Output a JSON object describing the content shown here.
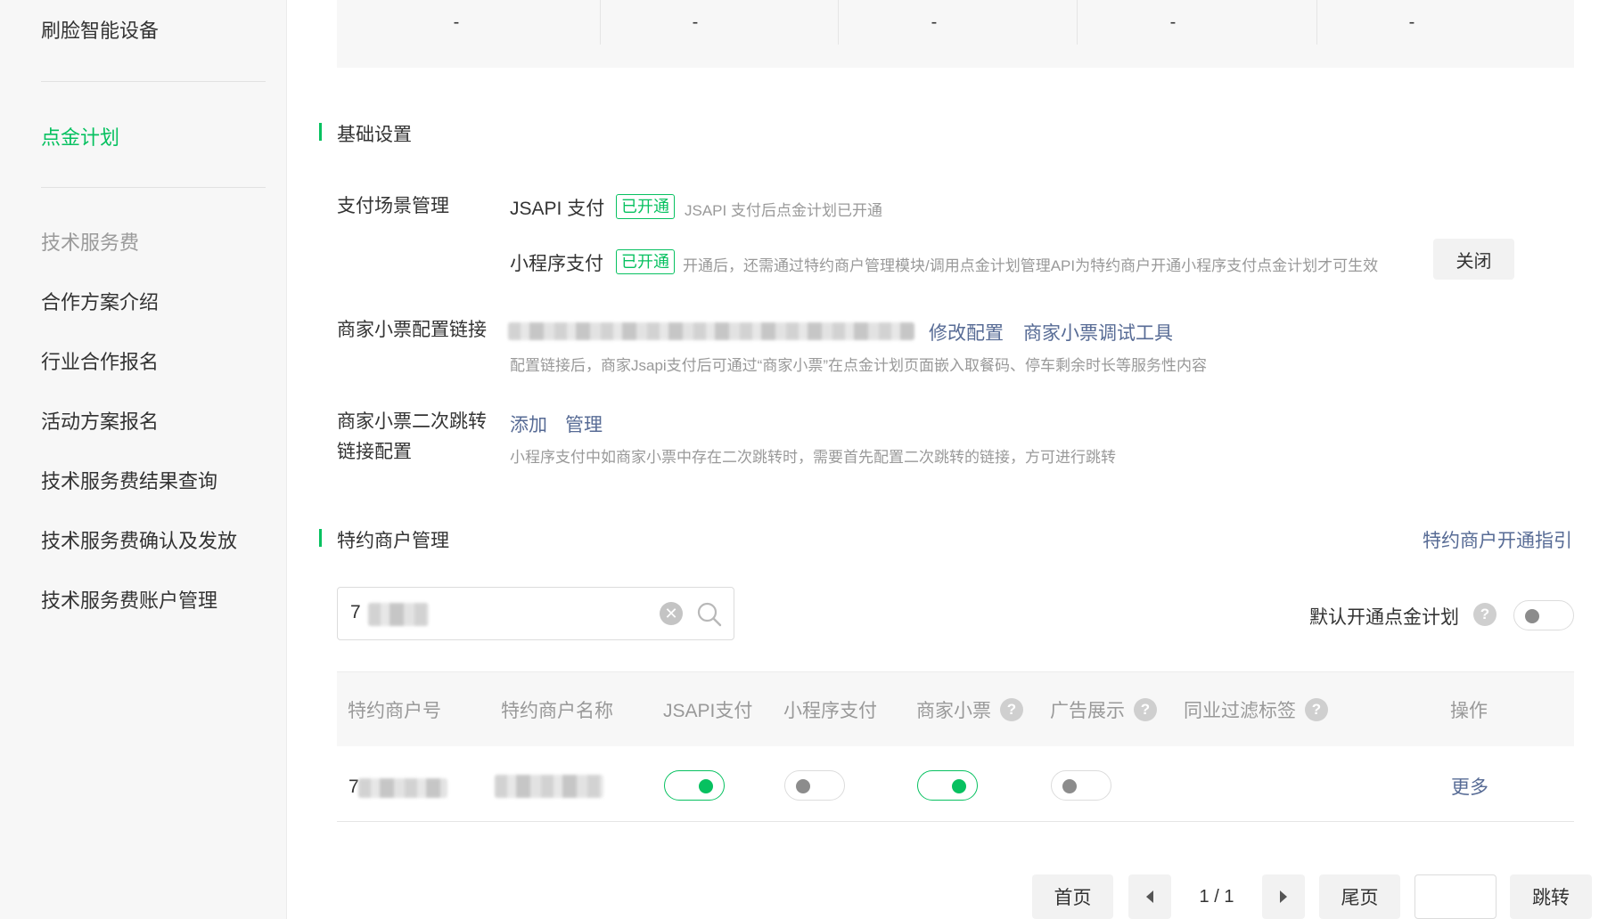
{
  "sidebar": {
    "top_item": "刷脸智能设备",
    "active_item": "点金计划",
    "group_title": "技术服务费",
    "items": [
      "合作方案介绍",
      "行业合作报名",
      "活动方案报名",
      "技术服务费结果查询",
      "技术服务费确认及发放",
      "技术服务费账户管理"
    ]
  },
  "summary": {
    "values": [
      "-",
      "-",
      "-",
      "-",
      "-"
    ]
  },
  "basic": {
    "title": "基础设置",
    "scene_label": "支付场景管理",
    "jsapi": {
      "name": "JSAPI 支付",
      "status": "已开通",
      "desc": "JSAPI 支付后点金计划已开通"
    },
    "mini": {
      "name": "小程序支付",
      "status": "已开通",
      "desc": "开通后，还需通过特约商户管理模块/调用点金计划管理API为特约商户开通小程序支付点金计划才可生效",
      "close_btn": "关闭"
    },
    "receipt_label": "商家小票配置链接",
    "receipt_modify": "修改配置",
    "receipt_debug": "商家小票调试工具",
    "receipt_hint": "配置链接后，商家Jsapi支付后可通过“商家小票”在点金计划页面嵌入取餐码、停车剩余时长等服务性内容",
    "redirect_label_1": "商家小票二次跳转",
    "redirect_label_2": "链接配置",
    "redirect_add": "添加",
    "redirect_manage": "管理",
    "redirect_hint": "小程序支付中如商家小票中存在二次跳转时，需要首先配置二次跳转的链接，方可进行跳转"
  },
  "merchant": {
    "title": "特约商户管理",
    "guide_link": "特约商户开通指引",
    "search_value": "7",
    "default_open_label": "默认开通点金计划",
    "default_open_on": false,
    "columns": [
      "特约商户号",
      "特约商户名称",
      "JSAPI支付",
      "小程序支付",
      "商家小票",
      "广告展示",
      "同业过滤标签",
      "操作"
    ],
    "rows": [
      {
        "id": "7",
        "jsapi_on": true,
        "mini_on": false,
        "receipt_on": true,
        "ad_on": false,
        "action": "更多"
      }
    ]
  },
  "pagination": {
    "first": "首页",
    "last": "尾页",
    "info": "1 / 1",
    "jump": "跳转"
  },
  "colors": {
    "accent": "#07c160",
    "link": "#576b95",
    "muted": "#999999"
  },
  "icons": {
    "clear": "clear-icon",
    "search": "search-icon",
    "help": "help-icon",
    "prev": "prev-page-icon",
    "next": "next-page-icon"
  }
}
